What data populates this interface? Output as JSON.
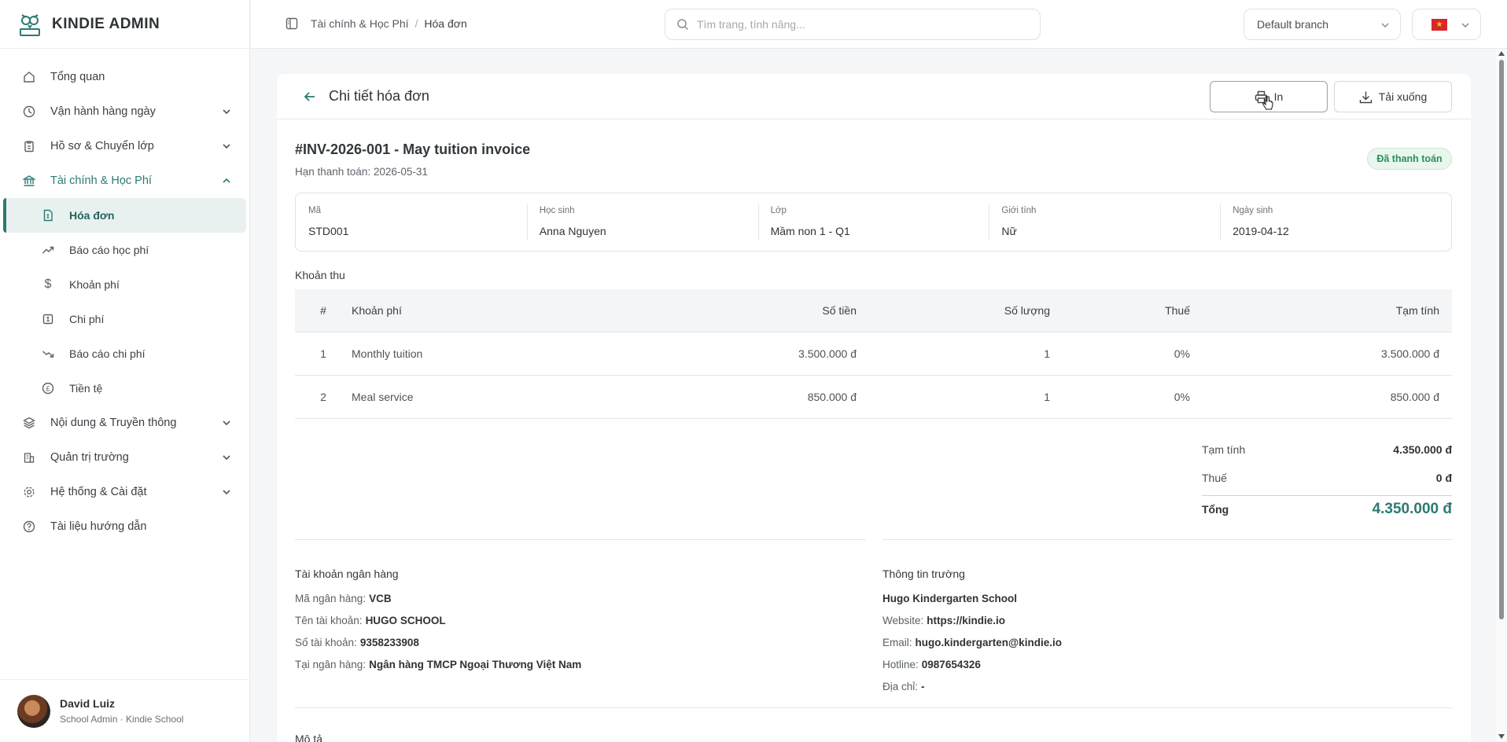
{
  "brand": {
    "name": "KINDIE ADMIN"
  },
  "sidebar": {
    "items": [
      {
        "label": "Tổng quan"
      },
      {
        "label": "Vận hành hàng ngày"
      },
      {
        "label": "Hồ sơ & Chuyển lớp"
      },
      {
        "label": "Tài chính & Học Phí"
      },
      {
        "label": "Nội dung & Truyền thông"
      },
      {
        "label": "Quản trị trường"
      },
      {
        "label": "Hệ thống & Cài đặt"
      },
      {
        "label": "Tài liệu hướng dẫn"
      }
    ],
    "finance_sub": [
      {
        "label": "Hóa đơn"
      },
      {
        "label": "Báo cáo học phí"
      },
      {
        "label": "Khoản phí"
      },
      {
        "label": "Chi phí"
      },
      {
        "label": "Báo cáo chi phí"
      },
      {
        "label": "Tiền tệ"
      }
    ]
  },
  "user": {
    "name": "David Luiz",
    "role": "School Admin · Kindie School"
  },
  "topbar": {
    "breadcrumb": [
      "Tài chính & Học Phí",
      "/",
      "Hóa đơn"
    ],
    "search_placeholder": "Tìm trang, tính năng...",
    "branch": "Default branch"
  },
  "invoice": {
    "header_title": "Chi tiết hóa đơn",
    "print_label": "In",
    "download_label": "Tải xuống",
    "title": "#INV-2026-001 - May tuition invoice",
    "due": "Hạn thanh toán: 2026-05-31",
    "status": "Đã thanh toán",
    "info": [
      {
        "label": "Mã",
        "value": "STD001"
      },
      {
        "label": "Học sinh",
        "value": "Anna Nguyen"
      },
      {
        "label": "Lớp",
        "value": "Mầm non 1 - Q1"
      },
      {
        "label": "Giới tính",
        "value": "Nữ"
      },
      {
        "label": "Ngày sinh",
        "value": "2019-04-12"
      }
    ],
    "section_label": "Khoản thu",
    "columns": [
      "#",
      "Khoản phí",
      "Số tiền",
      "Số lượng",
      "Thuế",
      "Tạm tính"
    ],
    "rows": [
      [
        "1",
        "Monthly tuition",
        "3.500.000 đ",
        "1",
        "0%",
        "3.500.000 đ"
      ],
      [
        "2",
        "Meal service",
        "850.000 đ",
        "1",
        "0%",
        "850.000 đ"
      ]
    ],
    "totals": {
      "subtotal_label": "Tạm tính",
      "subtotal": "4.350.000 đ",
      "tax_label": "Thuế",
      "tax": "0 đ",
      "total_label": "Tổng",
      "total": "4.350.000 đ"
    },
    "bank": {
      "heading": "Tài khoản ngân hàng",
      "code_label": "Mã ngân hàng:",
      "code": "VCB",
      "name_label": "Tên tài khoản:",
      "name": "HUGO SCHOOL",
      "number_label": "Số tài khoản:",
      "number": "9358233908",
      "at_label": "Tại ngân hàng:",
      "at": "Ngân hàng TMCP Ngoại Thương Việt Nam"
    },
    "school": {
      "heading": "Thông tin trường",
      "name": "Hugo Kindergarten School",
      "website_label": "Website:",
      "website": "https://kindie.io",
      "email_label": "Email:",
      "email": "hugo.kindergarten@kindie.io",
      "hotline_label": "Hotline:",
      "hotline": "0987654326",
      "address_label": "Địa chỉ:",
      "address": "-"
    },
    "description_label": "Mô tả"
  },
  "colors": {
    "accent": "#2c7a72",
    "paid": "#2b9154"
  }
}
